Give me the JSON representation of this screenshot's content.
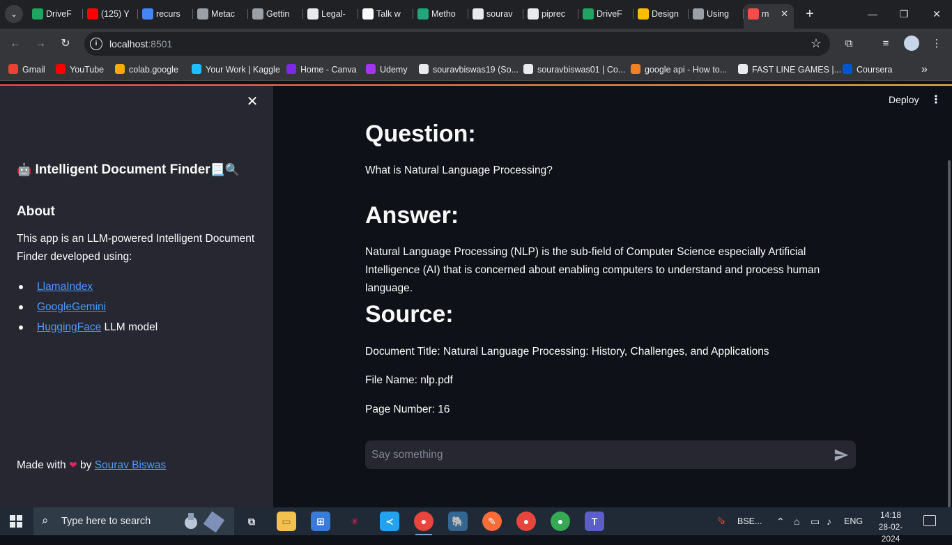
{
  "browser": {
    "tabs": [
      {
        "label": "DriveF",
        "icon": "google-drive-icon",
        "color": "#1fa463"
      },
      {
        "label": "(125) Y",
        "icon": "youtube-icon",
        "color": "#ff0000"
      },
      {
        "label": "recurs",
        "icon": "google-icon",
        "color": "#4285f4"
      },
      {
        "label": "Metac",
        "icon": "document-icon",
        "color": "#9aa0a6"
      },
      {
        "label": "Gettin",
        "icon": "document-icon",
        "color": "#9aa0a6"
      },
      {
        "label": "Legal-",
        "icon": "github-icon",
        "color": "#e8eaed"
      },
      {
        "label": "Talk w",
        "icon": "medium-icon",
        "color": "#ffffff"
      },
      {
        "label": "Metho",
        "icon": "papers-icon",
        "color": "#21a67a"
      },
      {
        "label": "sourav",
        "icon": "github-icon",
        "color": "#e8eaed"
      },
      {
        "label": "piprec",
        "icon": "box-icon",
        "color": "#e8eaed"
      },
      {
        "label": "DriveF",
        "icon": "google-drive-icon",
        "color": "#1fa463"
      },
      {
        "label": "Design",
        "icon": "google-drive-icon",
        "color": "#fbbc04"
      },
      {
        "label": "Using",
        "icon": "document-icon",
        "color": "#9aa0a6"
      },
      {
        "label": "m",
        "icon": "streamlit-icon",
        "color": "#ff4b4b"
      }
    ],
    "url_host": "localhost",
    "url_port": ":8501",
    "bookmarks": [
      {
        "label": "Gmail",
        "color": "#ea4335"
      },
      {
        "label": "YouTube",
        "color": "#ff0000"
      },
      {
        "label": "colab.google",
        "color": "#f9ab00"
      },
      {
        "label": "Your Work | Kaggle",
        "color": "#20beff"
      },
      {
        "label": "Home - Canva",
        "color": "#7d2ae8"
      },
      {
        "label": "Udemy",
        "color": "#a435f0"
      },
      {
        "label": "souravbiswas19 (So...",
        "color": "#e8eaed"
      },
      {
        "label": "souravbiswas01 | Co...",
        "color": "#e8eaed"
      },
      {
        "label": "google api - How to...",
        "color": "#f48024"
      },
      {
        "label": "FAST LINE GAMES |...",
        "color": "#e8eaed"
      },
      {
        "label": "Coursera",
        "color": "#0056d2"
      }
    ]
  },
  "sidebar": {
    "title": "Intelligent Document Finder",
    "title_emoji_before": "🤖",
    "title_emoji_after": "📃🔍",
    "about_heading": "About",
    "about_text": "This app is an LLM-powered Intelligent Document Finder developed using:",
    "links": [
      {
        "label": "LlamaIndex",
        "suffix": ""
      },
      {
        "label": "GoogleGemini",
        "suffix": ""
      },
      {
        "label": "HuggingFace",
        "suffix": " LLM model"
      }
    ],
    "footer_prefix": "Made with",
    "footer_by": "by",
    "footer_author": "Sourav Biswas"
  },
  "main": {
    "deploy_label": "Deploy",
    "question_heading": "Question:",
    "question_text": "What is Natural Language Processing?",
    "answer_heading": "Answer:",
    "answer_text": "Natural Language Processing (NLP) is the sub-field of Computer Science especially Artificial Intelligence (AI) that is concerned about enabling computers to understand and process human language.",
    "source_heading": "Source:",
    "source_title": "Document Title: Natural Language Processing: History, Challenges, and Applications",
    "source_file": "File Name: nlp.pdf",
    "source_page": "Page Number: 16",
    "chat_placeholder": "Say something"
  },
  "taskbar": {
    "search_placeholder": "Type here to search",
    "stock_label": "BSE...",
    "language": "ENG",
    "time": "14:18",
    "date": "28-02-2024"
  }
}
